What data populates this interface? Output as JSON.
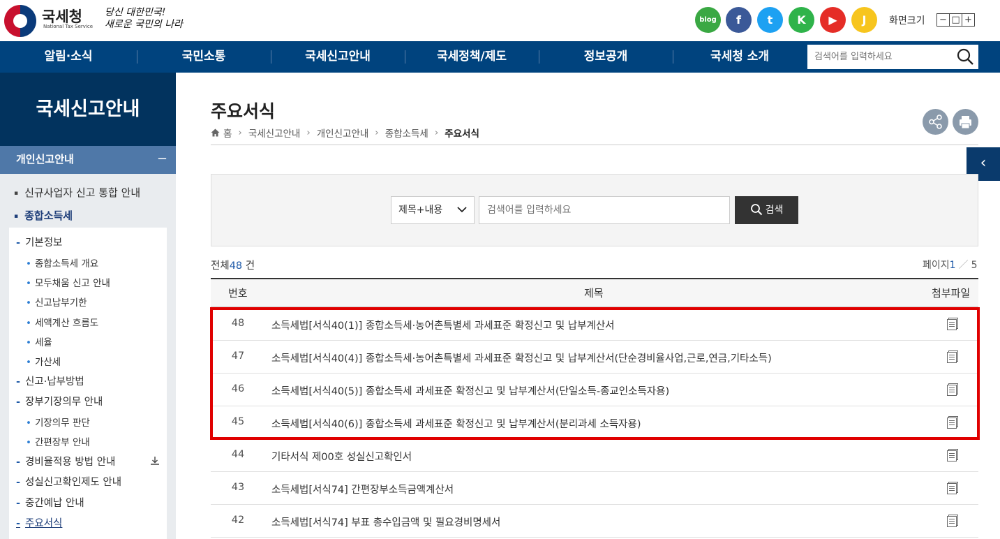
{
  "header": {
    "brand": "국세청",
    "brand_sub": "National Tax Service",
    "slogan_line1": "당신 대한민국!",
    "slogan_line2": "새로운 국민의 나라",
    "sns": [
      {
        "name": "blog",
        "label": "blog",
        "color": "#3aa843"
      },
      {
        "name": "facebook",
        "label": "f",
        "color": "#3b5998"
      },
      {
        "name": "twitter",
        "label": "t",
        "color": "#1da1f2"
      },
      {
        "name": "kakaostory",
        "label": "K",
        "color": "#2fb34a"
      },
      {
        "name": "youtube",
        "label": "▶",
        "color": "#e52d27"
      },
      {
        "name": "kakao",
        "label": "J",
        "color": "#f7c51e"
      }
    ],
    "fontsize_label": "화면크기",
    "fontsize_buttons": [
      "−",
      "□",
      "+"
    ]
  },
  "nav": {
    "items": [
      "알림·소식",
      "국민소통",
      "국세신고안내",
      "국세정책/제도",
      "정보공개",
      "국세청 소개"
    ],
    "search_placeholder": "검색어를 입력하세요"
  },
  "sidebar": {
    "title": "국세신고안내",
    "category": "개인신고안내",
    "category_toggle": "−",
    "items": [
      {
        "level": 1,
        "label": "신규사업자 신고 통합 안내"
      },
      {
        "level": 1,
        "label": "종합소득세",
        "active": true
      },
      {
        "level": 2,
        "label": "기본정보"
      },
      {
        "level": 3,
        "label": "종합소득세 개요"
      },
      {
        "level": 3,
        "label": "모두채움 신고 안내"
      },
      {
        "level": 3,
        "label": "신고납부기한"
      },
      {
        "level": 3,
        "label": "세액계산 흐름도"
      },
      {
        "level": 3,
        "label": "세율"
      },
      {
        "level": 3,
        "label": "가산세"
      },
      {
        "level": 2,
        "label": "신고·납부방법"
      },
      {
        "level": 2,
        "label": "장부기장의무 안내"
      },
      {
        "level": 3,
        "label": "기장의무 판단"
      },
      {
        "level": 3,
        "label": "간편장부 안내"
      },
      {
        "level": 2,
        "label": "경비율적용 방법 안내"
      },
      {
        "level": 2,
        "label": "성실신고확인제도 안내"
      },
      {
        "level": 2,
        "label": "중간예납 안내"
      },
      {
        "level": 2,
        "label": "주요서식",
        "active": true
      }
    ]
  },
  "main": {
    "title": "주요서식",
    "breadcrumb": [
      "홈",
      "국세신고안내",
      "개인신고안내",
      "종합소득세",
      "주요서식"
    ],
    "search": {
      "select_value": "제목+내용",
      "keyword_placeholder": "검색어를 입력하세요",
      "button_label": "검색"
    },
    "total_prefix": "전체",
    "total_count": "48",
    "total_suffix": " 건",
    "page_label": "페이지",
    "page_current": "1",
    "page_sep": "／",
    "page_total": "5",
    "table": {
      "headers": [
        "번호",
        "제목",
        "첨부파일"
      ],
      "rows": [
        {
          "no": "48",
          "title": "소득세법[서식40(1)] 종합소득세·농어촌특별세 과세표준 확정신고 및 납부계산서"
        },
        {
          "no": "47",
          "title": "소득세법[서식40(4)] 종합소득세·농어촌특별세 과세표준 확정신고 및 납부계산서(단순경비율사업,근로,연금,기타소득)"
        },
        {
          "no": "46",
          "title": "소득세법[서식40(5)] 종합소득세 과세표준 확정신고 및 납부계산서(단일소득-종교인소득자용)"
        },
        {
          "no": "45",
          "title": "소득세법[서식40(6)] 종합소득세 과세표준 확정신고 및 납부계산서(분리과세 소득자용)"
        },
        {
          "no": "44",
          "title": "기타서식 제00호 성실신고확인서"
        },
        {
          "no": "43",
          "title": "소득세법[서식74] 간편장부소득금액계산서"
        },
        {
          "no": "42",
          "title": "소득세법[서식74] 부표 총수입금액 및 필요경비명세서"
        }
      ]
    },
    "side_tab_label": "‹"
  },
  "colors": {
    "nav_bg": "#00437e",
    "side_head_bg": "#02335e",
    "side_cat_bg": "#4f78a8",
    "highlight": "#e00000"
  }
}
